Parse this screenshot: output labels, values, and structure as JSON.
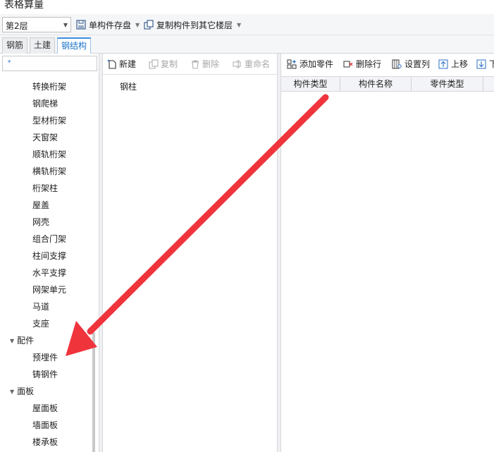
{
  "window": {
    "title": "表格算量"
  },
  "toolbar": {
    "floor_value": "第2层",
    "save_single": "单构件存盘",
    "copy_to_other_floor": "复制构件到其它楼层"
  },
  "tabs": [
    {
      "label": "钢筋"
    },
    {
      "label": "土建"
    },
    {
      "label": "钢结构",
      "active": true
    }
  ],
  "tree": {
    "search_placeholder": "",
    "items": [
      "转换桁架",
      "钢爬梯",
      "型材桁架",
      "天窗架",
      "顺轨桁架",
      "横轨桁架",
      "桁架柱",
      "屋盖",
      "网壳",
      "组合门架",
      "柱间支撑",
      "水平支撑",
      "网架单元",
      "马道",
      "支座"
    ],
    "group_accessories": {
      "label": "配件",
      "items": [
        "预埋件",
        "铸钢件"
      ]
    },
    "group_panels": {
      "label": "面板",
      "items": [
        "屋面板",
        "墙面板",
        "楼承板"
      ]
    }
  },
  "middle": {
    "new_label": "新建",
    "copy_label": "复制",
    "delete_label": "删除",
    "rename_label": "重命名",
    "list_items": [
      "钢柱"
    ]
  },
  "right": {
    "add_part": "添加零件",
    "delete_row": "删除行",
    "set_columns": "设置列",
    "move_up": "上移",
    "move_down_partial": "下",
    "columns": [
      "构件类型",
      "构件名称",
      "零件类型"
    ]
  },
  "colors": {
    "accent": "#3b8fe0",
    "annotation_arrow": "#f0343c",
    "disabled_text": "#a8a8a8"
  }
}
